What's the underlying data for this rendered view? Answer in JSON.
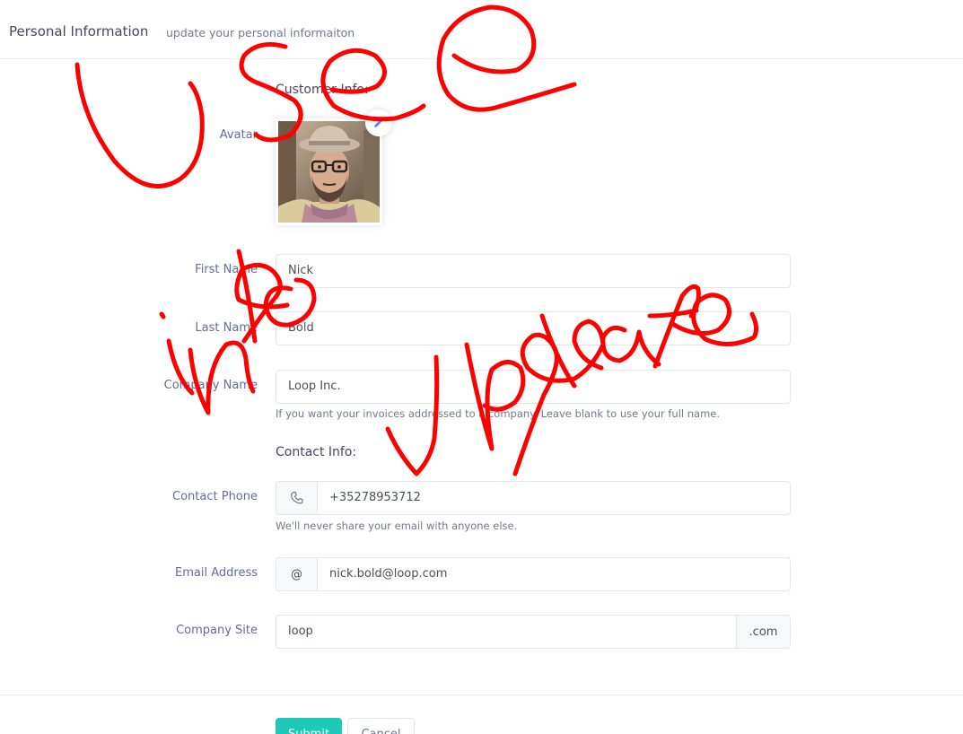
{
  "header": {
    "title": "Personal Information",
    "subtitle": "update your personal informaiton"
  },
  "customer_section": {
    "title": "Customer Info:"
  },
  "avatar": {
    "label": "Avatar",
    "edit_icon": "pencil-icon"
  },
  "fields": {
    "first_name": {
      "label": "First Name",
      "value": "Nick"
    },
    "last_name": {
      "label": "Last Name",
      "value": "Bold"
    },
    "company_name": {
      "label": "Company Name",
      "value": "Loop Inc.",
      "help": "If you want your invoices addressed to a company. Leave blank to use your full name."
    }
  },
  "contact_section": {
    "title": "Contact Info:"
  },
  "contact": {
    "phone": {
      "label": "Contact Phone",
      "icon": "phone-icon",
      "value": "+35278953712",
      "help": "We'll never share your email with anyone else."
    },
    "email": {
      "label": "Email Address",
      "addon": "@",
      "value": "nick.bold@loop.com"
    },
    "site": {
      "label": "Company Site",
      "value": "loop",
      "addon": ".com"
    }
  },
  "actions": {
    "submit_label": "Submit",
    "cancel_label": "Cancel"
  },
  "annotation": {
    "handwritten_text": "User info update",
    "color": "#ff0000"
  },
  "colors": {
    "submit": "#1dc9b7",
    "border": "#e2e5ec",
    "addon_bg": "#f7f8fa"
  }
}
